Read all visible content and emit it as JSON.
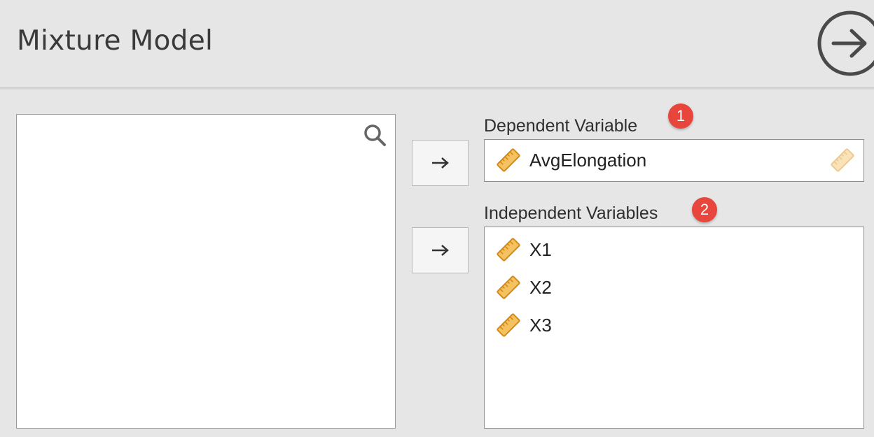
{
  "header": {
    "title": "Mixture Model"
  },
  "icons": {
    "run": "arrow-circle-right-icon",
    "search": "search-icon",
    "variable": "ruler-icon",
    "move": "right-arrow-icon"
  },
  "colors": {
    "badge": "#e8453c",
    "ruler_fill": "#f5c262",
    "ruler_stroke": "#d48a16",
    "background": "#e6e6e6"
  },
  "dependent": {
    "label": "Dependent Variable",
    "badge": "1",
    "variable": "AvgElongation"
  },
  "independent": {
    "label": "Independent Variables",
    "badge": "2",
    "variables": [
      "X1",
      "X2",
      "X3"
    ]
  }
}
